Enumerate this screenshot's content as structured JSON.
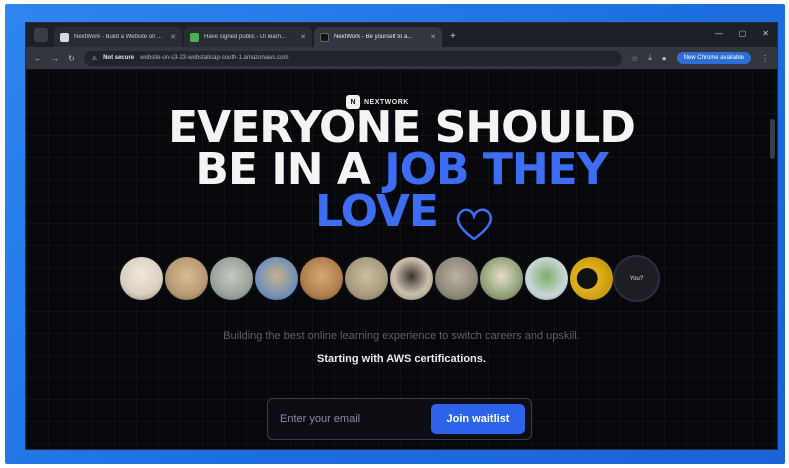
{
  "browser": {
    "tabs": [
      {
        "title": "NextWork - Build a Website on ...",
        "favicon_color": "#d8d8d8",
        "active": false
      },
      {
        "title": "Have signed public - UI learn...",
        "favicon_color": "#49b04f",
        "active": false
      },
      {
        "title": "NextWork - Be yourself to a...",
        "favicon_color": "#111111",
        "active": true
      }
    ],
    "new_tab": "+",
    "not_secure_label": "Not secure",
    "url": "website-on-s3-23-webstaticap-south-1.amazonaws.com",
    "relaunch_label": "New Chrome available"
  },
  "page": {
    "logo_text": "NEXTWORK",
    "logo_mark": "N",
    "headline_line1": "EVERYONE SHOULD",
    "headline_line2_white": "BE IN A ",
    "headline_line2_blue": "JOB THEY",
    "headline_line3": "LOVE",
    "more_avatar_label": "You?",
    "subtitle": "Building the best online learning experience to switch careers and upskill.",
    "subtitle_bold": "Starting with AWS certifications.",
    "email_placeholder": "Enter your email",
    "join_button": "Join waitlist"
  },
  "colors": {
    "accent_blue": "#3d6df2",
    "button_blue": "#2d63e8",
    "background": "#07080c"
  },
  "avatars": [
    {
      "name": "alpaca",
      "color": "#d9cfc2"
    },
    {
      "name": "hamster",
      "color": "#b89a74"
    },
    {
      "name": "koala",
      "color": "#9aa39b"
    },
    {
      "name": "goat",
      "color": "#6e8fb8"
    },
    {
      "name": "dog",
      "color": "#b07f4e"
    },
    {
      "name": "lion",
      "color": "#a69b80"
    },
    {
      "name": "pug",
      "color": "#cbbfae"
    },
    {
      "name": "seal",
      "color": "#8e8a7c"
    },
    {
      "name": "llama",
      "color": "#92a37a"
    },
    {
      "name": "cactus",
      "color": "#c9d6d8"
    },
    {
      "name": "toucan",
      "color": "#e0b21e"
    }
  ]
}
